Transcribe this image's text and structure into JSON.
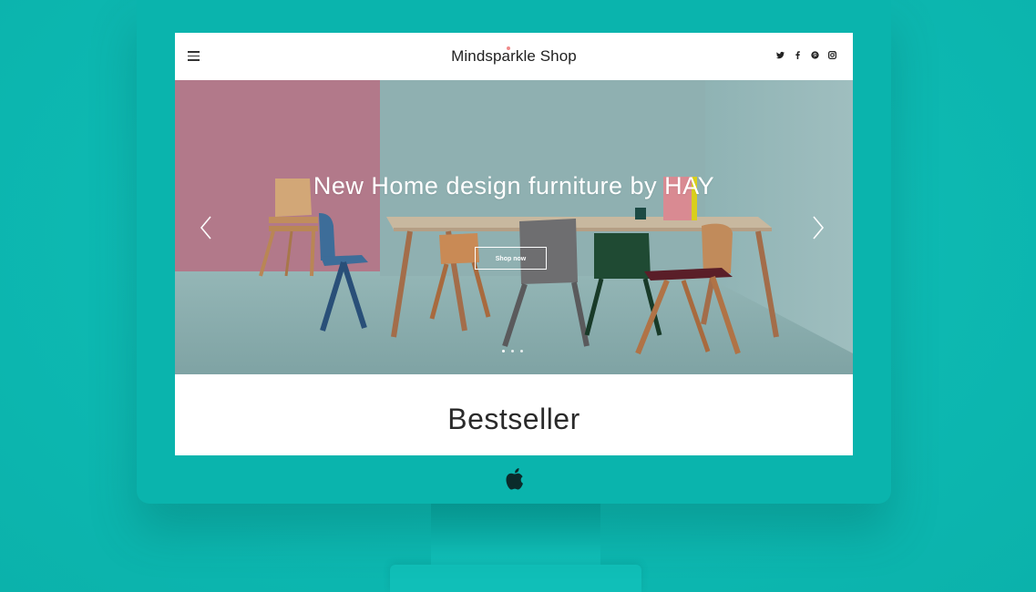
{
  "shop": {
    "brand": "Mindsparkle Shop",
    "menu_icon": "hamburger-menu-icon",
    "social": [
      "twitter-icon",
      "facebook-icon",
      "pinterest-icon",
      "instagram-icon"
    ]
  },
  "hero": {
    "title": "New Home design furniture by HAY",
    "cta": "Shop now",
    "slides": 3,
    "active_slide": 1
  },
  "section": {
    "title": "Bestseller"
  },
  "colors": {
    "background": "#0fbfb8",
    "monitor": "#0ab4ad",
    "accent_dot": "#f08a8a"
  }
}
